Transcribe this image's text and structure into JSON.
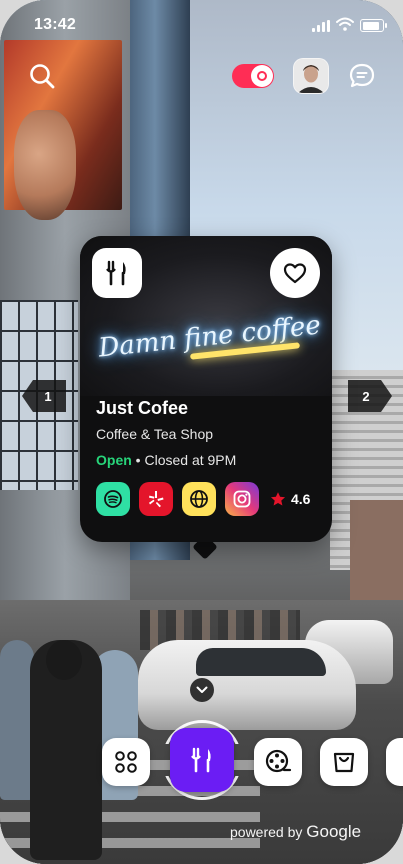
{
  "status_bar": {
    "time": "13:42"
  },
  "top_bar": {
    "icons": [
      "search-icon",
      "live-toggle",
      "avatar",
      "chat-icon"
    ],
    "toggle_color": "#ff2d55"
  },
  "place_card": {
    "category_icon": "utensils-icon",
    "favorite_icon": "heart-icon",
    "name": "Just Cofee",
    "category": "Coffee & Tea Shop",
    "status": "Open",
    "hours_separator": "•",
    "hours_text": "Closed at 9PM",
    "open_color": "#27d57a",
    "neon_sign": "Damn fine coffee",
    "links": [
      {
        "icon": "spotify-icon",
        "color": "#2fe0a4"
      },
      {
        "icon": "yelp-icon",
        "color": "#e4152b"
      },
      {
        "icon": "globe-icon",
        "color": "#ffe15b"
      },
      {
        "icon": "instagram-icon",
        "color": "#d53b8b"
      }
    ],
    "rating": "4.6"
  },
  "nav": {
    "prev": "1",
    "next": "2"
  },
  "bottom_bar": {
    "buttons": [
      "apps-icon",
      "food-icon",
      "film-icon",
      "bag-icon"
    ],
    "active_color": "#6b1df4",
    "powered_prefix": "powered by",
    "powered_brand": "Google"
  }
}
